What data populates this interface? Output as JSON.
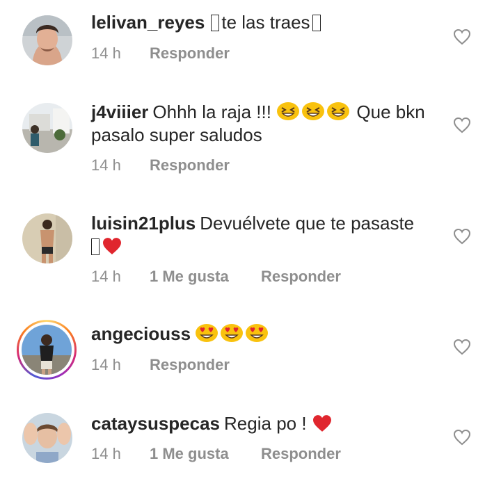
{
  "comments": [
    {
      "username": "lelivan_reyes",
      "text_before": "",
      "text": "te las traes",
      "time": "14 h",
      "likes": "",
      "reply_label": "Responder"
    },
    {
      "username": "j4viiier",
      "text": "Ohhh la raja !!!",
      "text_after": "Que bkn pasalo super saludos",
      "time": "14 h",
      "likes": "",
      "reply_label": "Responder"
    },
    {
      "username": "luisin21plus",
      "text": "Devuélvete que te pasaste",
      "time": "14 h",
      "likes": "1 Me gusta",
      "reply_label": "Responder"
    },
    {
      "username": "angeciouss",
      "text": "",
      "time": "14 h",
      "likes": "",
      "reply_label": "Responder"
    },
    {
      "username": "cataysuspecas",
      "text": "Regia po !",
      "time": "14 h",
      "likes": "1 Me gusta",
      "reply_label": "Responder"
    }
  ],
  "icons": {
    "like": "heart-outline-icon",
    "heart_emoji": "red-heart-emoji",
    "grin_emoji": "grinning-squinting-face-emoji",
    "heart_eyes_emoji": "smiling-face-with-heart-eyes-emoji"
  },
  "colors": {
    "text": "#262626",
    "meta": "#8e8e8e",
    "heart": "#ed4956",
    "emoji": "#f9c20e"
  }
}
